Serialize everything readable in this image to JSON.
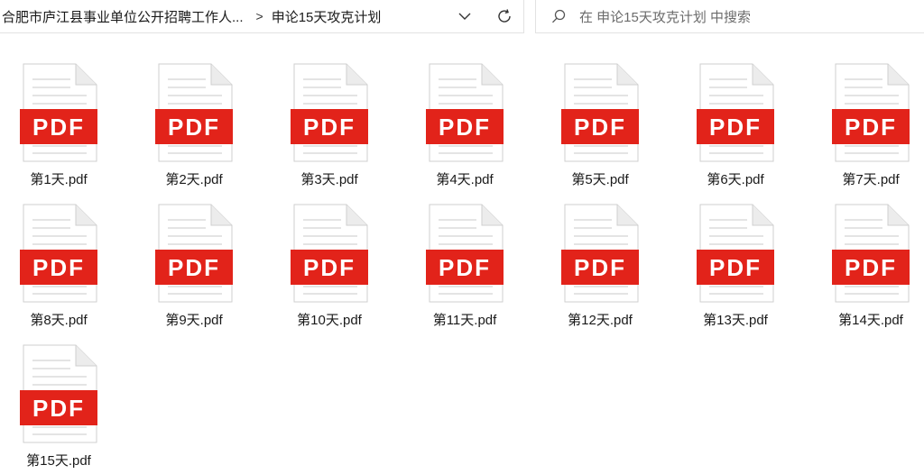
{
  "address_bar": {
    "crumbs": [
      "合肥市庐江县事业单位公开招聘工作人...",
      "申论15天攻克计划"
    ],
    "separator": ">"
  },
  "search": {
    "placeholder": "在 申论15天攻克计划 中搜索"
  },
  "file_icon": {
    "label": "PDF",
    "banner_color": "#e2231a",
    "page_color": "#ffffff",
    "line_color": "#d9d9d9"
  },
  "files": [
    {
      "name": "第1天.pdf"
    },
    {
      "name": "第2天.pdf"
    },
    {
      "name": "第3天.pdf"
    },
    {
      "name": "第4天.pdf"
    },
    {
      "name": "第5天.pdf"
    },
    {
      "name": "第6天.pdf"
    },
    {
      "name": "第7天.pdf"
    },
    {
      "name": "第8天.pdf"
    },
    {
      "name": "第9天.pdf"
    },
    {
      "name": "第10天.pdf"
    },
    {
      "name": "第11天.pdf"
    },
    {
      "name": "第12天.pdf"
    },
    {
      "name": "第13天.pdf"
    },
    {
      "name": "第14天.pdf"
    },
    {
      "name": "第15天.pdf"
    }
  ]
}
